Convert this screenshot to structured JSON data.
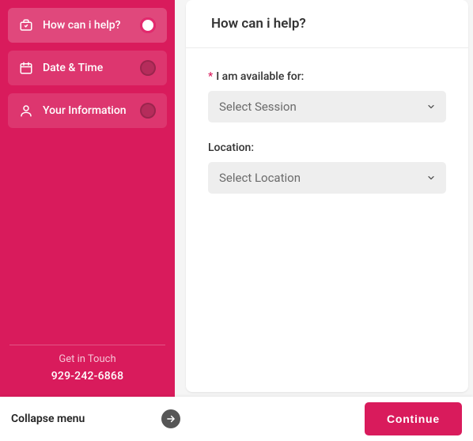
{
  "sidebar": {
    "steps": [
      {
        "label": "How can i help?"
      },
      {
        "label": "Date & Time"
      },
      {
        "label": "Your Information"
      }
    ],
    "contact": {
      "label": "Get in Touch",
      "phone": "929-242-6868"
    }
  },
  "main": {
    "title": "How can i help?",
    "fields": {
      "session": {
        "label": "I am available for:",
        "placeholder": "Select Session"
      },
      "location": {
        "label": "Location:",
        "placeholder": "Select Location"
      }
    }
  },
  "bottom": {
    "collapse_label": "Collapse menu",
    "continue_label": "Continue"
  },
  "required_mark": "*"
}
